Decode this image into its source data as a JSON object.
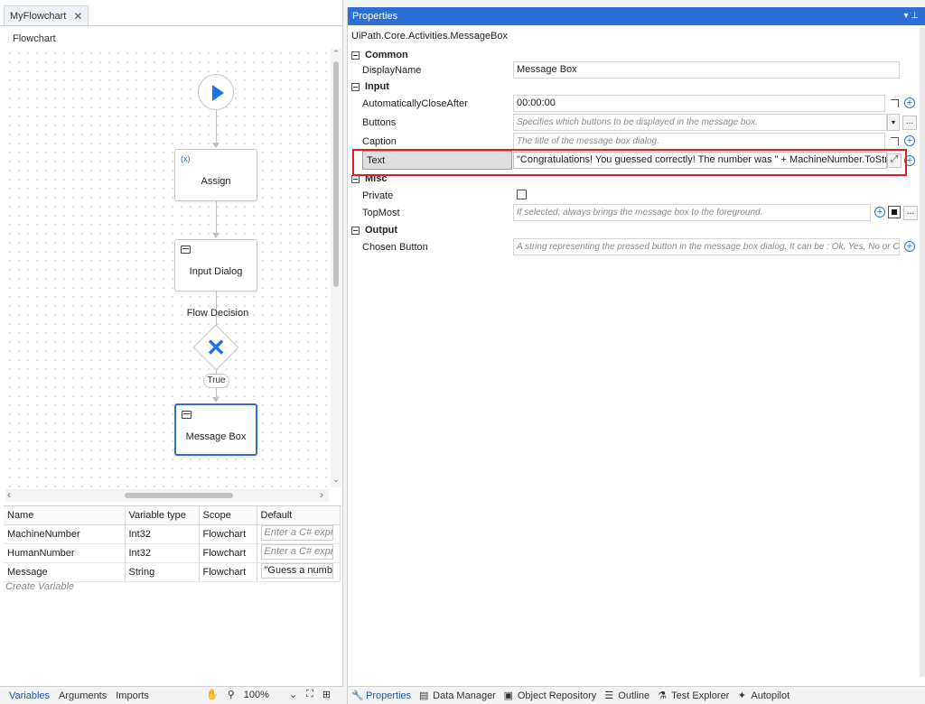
{
  "document_tab": {
    "title": "MyFlowchart",
    "close": "✕"
  },
  "breadcrumb": "Flowchart",
  "flowchart": {
    "assign": {
      "icon": "(x)",
      "label": "Assign"
    },
    "input_dialog": {
      "label": "Input Dialog"
    },
    "decision": {
      "label": "Flow Decision",
      "branch": "True"
    },
    "message_box": {
      "label": "Message Box"
    }
  },
  "scroll": {
    "up": "⌃",
    "down": "⌄",
    "left": "‹",
    "right": "›"
  },
  "variables": {
    "headers": [
      "Name",
      "Variable type",
      "Scope",
      "Default"
    ],
    "rows": [
      {
        "name": "MachineNumber",
        "type": "Int32",
        "scope": "Flowchart",
        "default": "Enter a C# express"
      },
      {
        "name": "HumanNumber",
        "type": "Int32",
        "scope": "Flowchart",
        "default": "Enter a C# express"
      },
      {
        "name": "Message",
        "type": "String",
        "scope": "Flowchart",
        "default": "\"Guess a number f"
      }
    ],
    "create": "Create Variable"
  },
  "left_bottom": {
    "tabs": [
      "Variables",
      "Arguments",
      "Imports"
    ],
    "zoom": "100%",
    "pan_icon": "✋",
    "search_icon": "⚲",
    "zoom_dropdown_icon": "⌄",
    "fit_icon": "⛶",
    "overview_icon": "⊞"
  },
  "properties": {
    "header": "Properties",
    "header_controls": "▾  ⊥",
    "activity_type": "UiPath.Core.Activities.MessageBox",
    "categories": {
      "common": "Common",
      "input": "Input",
      "misc": "Misc",
      "output": "Output"
    },
    "rows": {
      "display_name": {
        "name": "DisplayName",
        "value": "Message Box"
      },
      "auto_close": {
        "name": "AutomaticallyCloseAfter",
        "value": "00:00:00"
      },
      "buttons": {
        "name": "Buttons",
        "placeholder": "Specifies which buttons to be displayed in the message box."
      },
      "caption": {
        "name": "Caption",
        "placeholder": "The title of the message box dialog."
      },
      "text": {
        "name": "Text",
        "value": "\"Congratulations! You guessed correctly! The number was \" + MachineNumber.ToString()"
      },
      "private": {
        "name": "Private"
      },
      "topmost": {
        "name": "TopMost",
        "placeholder": "If selected, always brings the message box to the foreground."
      },
      "chosen_button": {
        "name": "Chosen Button",
        "placeholder": "A string representing the pressed button in the message box dialog. It can be : Ok, Yes, No or Cance"
      }
    },
    "plus": "+",
    "dropdown": "▾",
    "ellipsis": "..."
  },
  "right_bottom_tabs": [
    {
      "label": "Properties",
      "icon": "🔧"
    },
    {
      "label": "Data Manager",
      "icon": "▤"
    },
    {
      "label": "Object Repository",
      "icon": "▣"
    },
    {
      "label": "Outline",
      "icon": "☰"
    },
    {
      "label": "Test Explorer",
      "icon": "⚗"
    },
    {
      "label": "Autopilot",
      "icon": "✦"
    }
  ]
}
